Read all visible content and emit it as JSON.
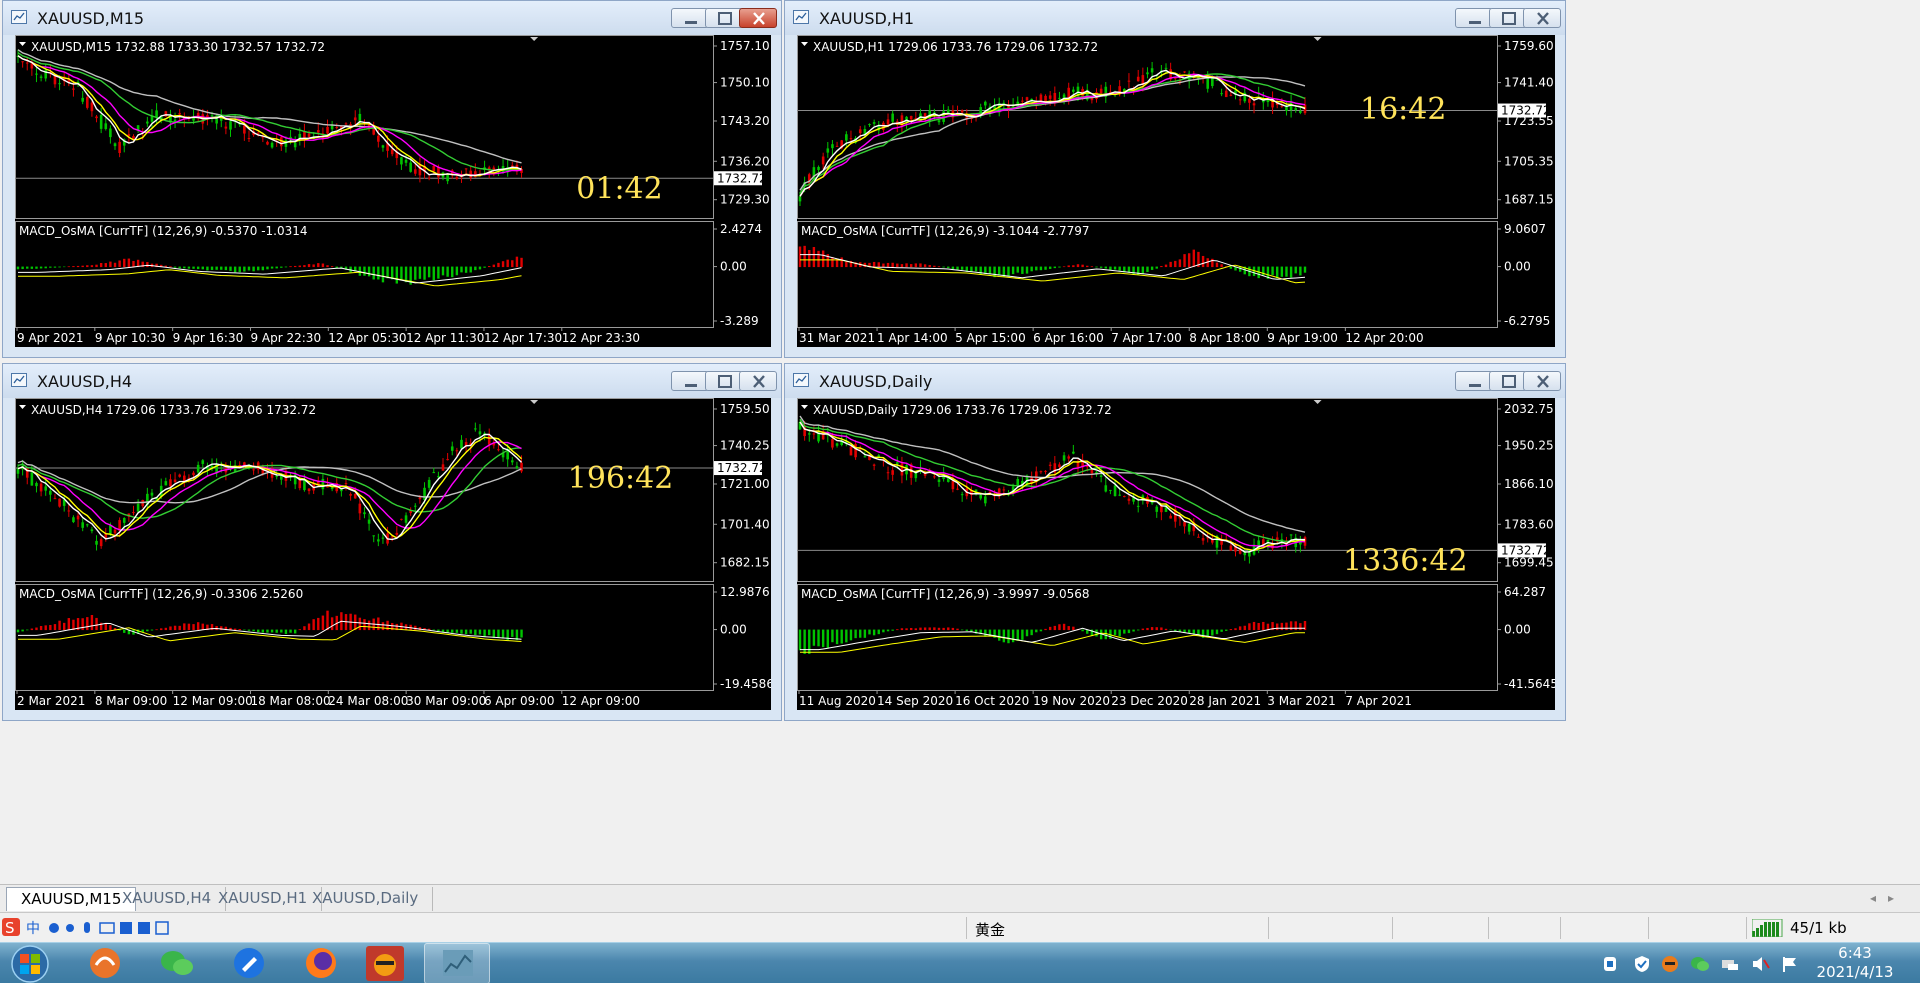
{
  "windows": {
    "m15": {
      "title": "XAUUSD,M15",
      "info": "XAUUSD,M15  1732.88 1733.30 1732.57 1732.72",
      "price_ticks": [
        "1757.10",
        "1750.10",
        "1743.20",
        "1736.20",
        "1729.30"
      ],
      "current_price": "1732.72",
      "countdown": "01:42",
      "macd_label": "MACD_OsMA [CurrTF] (12,26,9) -0.5370 -1.0314",
      "macd_ticks": [
        "2.4274",
        "0.00",
        "-3.289"
      ],
      "time_ticks": [
        "9 Apr 2021",
        "9 Apr 10:30",
        "9 Apr 16:30",
        "9 Apr 22:30",
        "12 Apr 05:30",
        "12 Apr 11:30",
        "12 Apr 17:30",
        "12 Apr 23:30"
      ]
    },
    "h1": {
      "title": "XAUUSD,H1",
      "info": "XAUUSD,H1  1729.06 1733.76 1729.06 1732.72",
      "price_ticks": [
        "1759.60",
        "1741.40",
        "1723.55",
        "1705.35",
        "1687.15"
      ],
      "current_price": "1732.72",
      "countdown": "16:42",
      "macd_label": "MACD_OsMA [CurrTF] (12,26,9) -3.1044 -2.7797",
      "macd_ticks": [
        "9.0607",
        "0.00",
        "-6.2795"
      ],
      "time_ticks": [
        "31 Mar 2021",
        "1 Apr 14:00",
        "5 Apr 15:00",
        "6 Apr 16:00",
        "7 Apr 17:00",
        "8 Apr 18:00",
        "9 Apr 19:00",
        "12 Apr 20:00"
      ]
    },
    "h4": {
      "title": "XAUUSD,H4",
      "info": "XAUUSD,H4  1729.06 1733.76 1729.06 1732.72",
      "price_ticks": [
        "1759.50",
        "1740.25",
        "1721.00",
        "1701.40",
        "1682.15"
      ],
      "current_price": "1732.72",
      "countdown": "196:42",
      "macd_label": "MACD_OsMA [CurrTF] (12,26,9) -0.3306 2.5260",
      "macd_ticks": [
        "12.9876",
        "0.00",
        "-19.4586"
      ],
      "time_ticks": [
        "2 Mar 2021",
        "8 Mar 09:00",
        "12 Mar 09:00",
        "18 Mar 08:00",
        "24 Mar 08:00",
        "30 Mar 09:00",
        "6 Apr 09:00",
        "12 Apr 09:00"
      ]
    },
    "daily": {
      "title": "XAUUSD,Daily",
      "info": "XAUUSD,Daily  1729.06 1733.76 1729.06 1732.72",
      "price_ticks": [
        "2032.75",
        "1950.25",
        "1866.10",
        "1783.60",
        "1699.45"
      ],
      "current_price": "1732.72",
      "countdown": "1336:42",
      "macd_label": "MACD_OsMA [CurrTF] (12,26,9) -3.9997 -9.0568",
      "macd_ticks": [
        "64.287",
        "0.00",
        "-41.5645"
      ],
      "time_ticks": [
        "11 Aug 2020",
        "14 Sep 2020",
        "16 Oct 2020",
        "19 Nov 2020",
        "23 Dec 2020",
        "28 Jan 2021",
        "3 Mar 2021",
        "7 Apr 2021"
      ]
    }
  },
  "tabs": [
    {
      "label": "XAUUSD,M15",
      "active": true
    },
    {
      "label": "XAUUSD,H4",
      "active": false
    },
    {
      "label": "XAUUSD,H1",
      "active": false
    },
    {
      "label": "XAUUSD,Daily",
      "active": false
    }
  ],
  "statusbar": {
    "symbol_text": "黄金",
    "connection": "45/1 kb"
  },
  "taskbar": {
    "time": "6:43",
    "date": "2021/4/13"
  },
  "colors": {
    "bull": "#00c400",
    "bear": "#e00000",
    "ma_white": "#ffffff",
    "ma_yellow": "#ffff00",
    "ma_magenta": "#ff00ff",
    "ma_green": "#33cc33",
    "ma_gray": "#c0c0c0",
    "countdown": "#ffe35a"
  },
  "icons": [
    "chart-window-icon",
    "minimize-icon",
    "maximize-icon",
    "close-icon",
    "start-orb-icon",
    "network-bars-icon"
  ]
}
